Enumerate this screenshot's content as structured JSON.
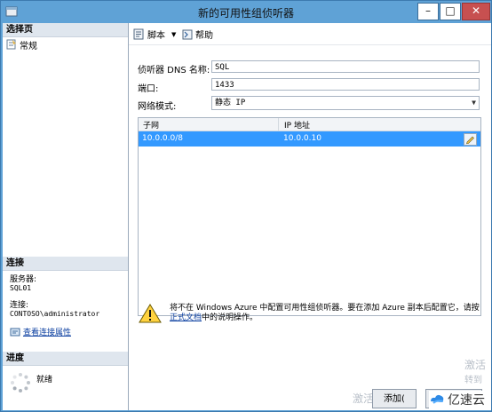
{
  "window": {
    "title": "新的可用性组侦听器"
  },
  "controls": {
    "minimize": "–",
    "maximize": "□",
    "close": "✕"
  },
  "left_panel": {
    "select_page_header": "选择页",
    "pages": [
      {
        "label": "常规"
      }
    ],
    "connection_header": "连接",
    "server_label": "服务器:",
    "server_value": "SQL01",
    "connection_label": "连接:",
    "connection_value": "CONTOSO\\administrator",
    "view_properties_link": "查看连接属性",
    "progress_header": "进度",
    "progress_status": "就绪"
  },
  "toolbar": {
    "script_label": "脚本",
    "help_label": "帮助"
  },
  "form": {
    "dns_label": "侦听器 DNS 名称:",
    "dns_value": "SQL",
    "port_label": "端口:",
    "port_value": "1433",
    "network_mode_label": "网络模式:",
    "network_mode_value": "静态 IP"
  },
  "grid": {
    "columns": [
      "子网",
      "IP 地址"
    ],
    "rows": [
      {
        "subnet": "10.0.0.0/8",
        "ip": "10.0.0.10"
      }
    ]
  },
  "warning": {
    "text_before_link": "将不在 Windows Azure 中配置可用性组侦听器。要在添加 Azure 副本后配置它，请按",
    "link": "正式文档",
    "text_after_link": "中的说明操作。"
  },
  "buttons": {
    "add_label": "添加("
  },
  "watermarks": {
    "activate": "激活",
    "goto": "转到",
    "activate2": "激活",
    "brand": "亿速云"
  },
  "colors": {
    "titlebar": "#5fa2d6",
    "selection": "#3399ff",
    "close_button": "#c75050"
  }
}
